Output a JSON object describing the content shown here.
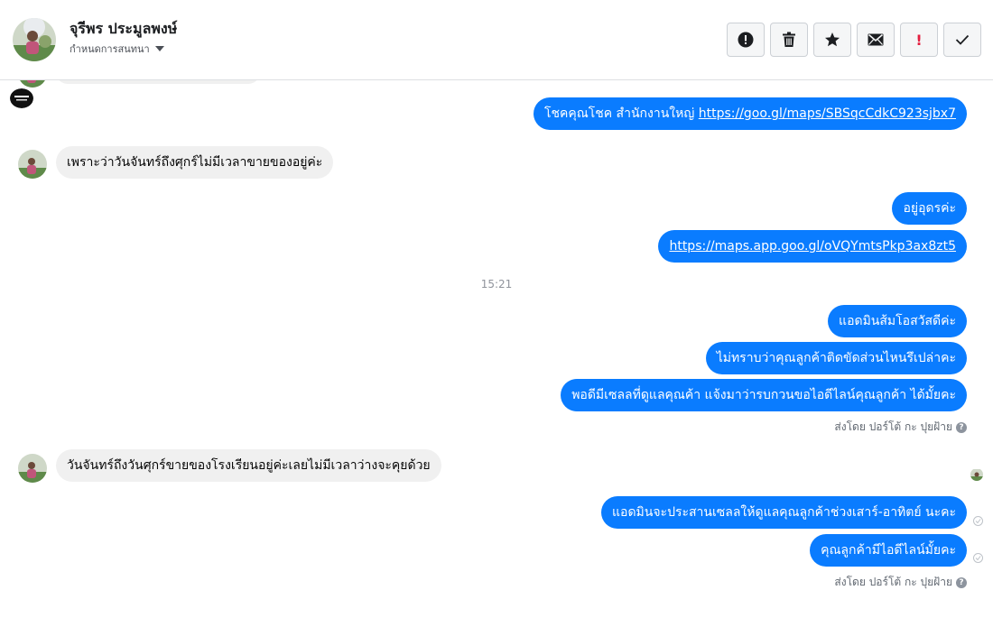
{
  "header": {
    "contact_name": "จุรีพร ประมูลพงษ์",
    "assign_label": "กำหนดการสนทนา",
    "toolbar": {
      "spam": "exclamation-circle-icon",
      "delete": "trash-icon",
      "star": "star-icon",
      "unread": "envelope-icon",
      "follow_up": "!",
      "done": "check-icon"
    }
  },
  "messages": [
    {
      "dir": "out",
      "text": "โชคคุณโชค สำนักงานใหญ่ ",
      "link": "https://goo.gl/maps/SBSqcCdkC923sjbx7"
    },
    {
      "dir": "in",
      "text": "เพราะว่าวันจันทร์ถึงศุกร์ไม่มีเวลาขายของอยู่ค่ะ"
    },
    {
      "dir": "out",
      "text": "อยู่อุดรค่ะ"
    },
    {
      "dir": "out",
      "link": "https://maps.app.goo.gl/oVQYmtsPkp3ax8zt5"
    },
    {
      "dir": "out",
      "text": "แอดมินส้มโอสวัสดีค่ะ"
    },
    {
      "dir": "out",
      "text": "ไม่ทราบว่าคุณลูกค้าติดขัดส่วนไหนรึเปล่าคะ"
    },
    {
      "dir": "out",
      "text": "พอดีมีเซลลที่ดูแลคุณค้า แจ้งมาว่ารบกวนขอไอดีไลน์คุณลูกค้า ได้มั้ยคะ"
    },
    {
      "dir": "in",
      "text": "วันจันทร์ถึงวันศุกร์ขายของโรงเรียนอยู่ค่ะเลยไม่มีเวลาว่างจะคุยด้วย"
    },
    {
      "dir": "out",
      "text": "แอดมินจะประสานเซลลให้ดูแลคุณลูกค้าช่วงเสาร์-อาทิตย์ นะคะ"
    },
    {
      "dir": "out",
      "text": "คุณลูกค้ามีไอดีไลน์มั้ยคะ"
    }
  ],
  "time_separator": "15:21",
  "sent_by_1": "ส่งโดย ปอร์โต้ กะ ปุยฝ้าย",
  "sent_by_2": "ส่งโดย ปอร์โต้ กะ ปุยฝ้าย",
  "help_glyph": "?",
  "colors": {
    "outgoing_bubble": "#0a7cff",
    "incoming_bubble": "#f0f0f0",
    "follow_up_red": "#e41e3f"
  }
}
